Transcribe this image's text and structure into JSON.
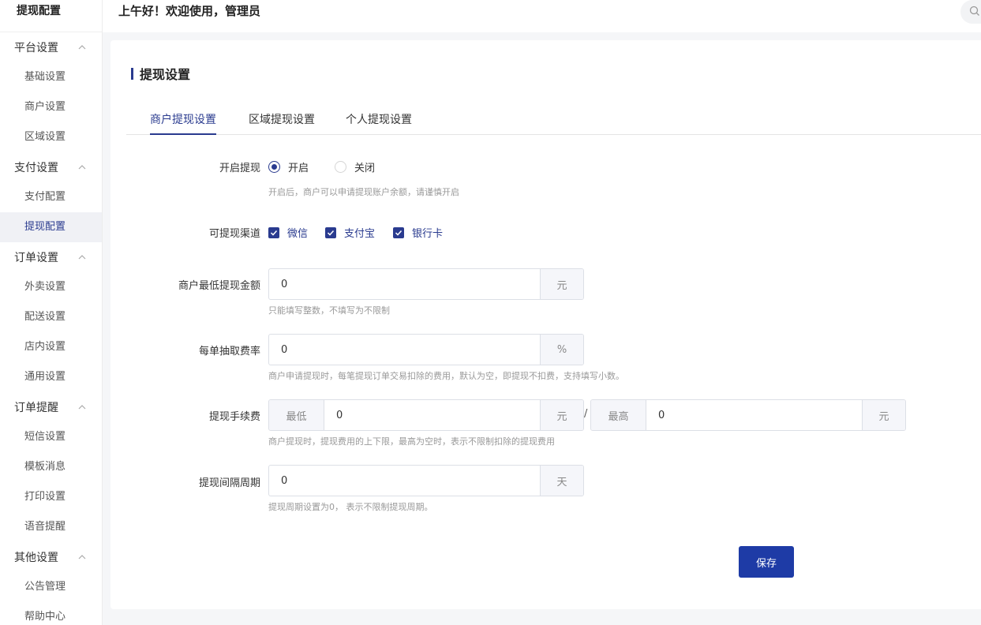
{
  "sidebar": {
    "title": "提现配置",
    "groups": [
      {
        "label": "平台设置",
        "items": [
          "基础设置",
          "商户设置",
          "区域设置"
        ]
      },
      {
        "label": "支付设置",
        "items": [
          "支付配置",
          "提现配置"
        ]
      },
      {
        "label": "订单设置",
        "items": [
          "外卖设置",
          "配送设置",
          "店内设置",
          "通用设置"
        ]
      },
      {
        "label": "订单提醒",
        "items": [
          "短信设置",
          "模板消息",
          "打印设置",
          "语音提醒"
        ]
      },
      {
        "label": "其他设置",
        "items": [
          "公告管理",
          "帮助中心"
        ]
      }
    ],
    "active_item": "提现配置"
  },
  "header": {
    "greeting": "上午好！欢迎使用，管理员",
    "search_icon": "search-icon"
  },
  "card": {
    "title": "提现设置",
    "tabs": [
      {
        "label": "商户提现设置",
        "active": true
      },
      {
        "label": "区域提现设置",
        "active": false
      },
      {
        "label": "个人提现设置",
        "active": false
      }
    ]
  },
  "form": {
    "enable": {
      "label": "开启提现",
      "options": [
        "开启",
        "关闭"
      ],
      "selected": "开启",
      "hint": "开启后，商户可以申请提现账户余额，请谨慎开启"
    },
    "channels": {
      "label": "可提现渠道",
      "options": [
        {
          "label": "微信",
          "checked": true
        },
        {
          "label": "支付宝",
          "checked": true
        },
        {
          "label": "银行卡",
          "checked": true
        }
      ]
    },
    "min_amount": {
      "label": "商户最低提现金额",
      "value": "0",
      "unit": "元",
      "hint": "只能填写整数，不填写为不限制"
    },
    "fee_rate": {
      "label": "每单抽取费率",
      "value": "0",
      "unit": "%",
      "hint": "商户申请提现时，每笔提现订单交易扣除的费用，默认为空，即提现不扣费，支持填写小数。"
    },
    "service_fee": {
      "label": "提现手续费",
      "min_prefix": "最低",
      "min_value": "0",
      "min_unit": "元",
      "separator": "/",
      "max_prefix": "最高",
      "max_value": "0",
      "max_unit": "元",
      "hint": "商户提现时，提现费用的上下限，最高为空时，表示不限制扣除的提现费用"
    },
    "interval": {
      "label": "提现间隔周期",
      "value": "0",
      "unit": "天",
      "hint": "提现周期设置为0， 表示不限制提现周期。"
    },
    "save_label": "保存"
  },
  "colors": {
    "primary": "#2a3b8f",
    "button": "#1e3ba6"
  }
}
